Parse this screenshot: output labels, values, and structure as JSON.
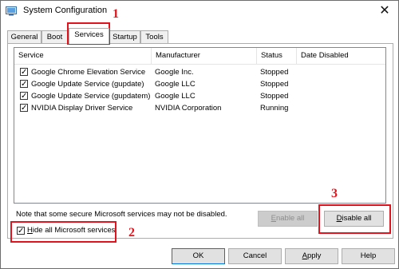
{
  "window": {
    "title": "System Configuration",
    "close_glyph": "✕"
  },
  "tabs": [
    {
      "label": "General"
    },
    {
      "label": "Boot"
    },
    {
      "label": "Services",
      "active": true
    },
    {
      "label": "Startup"
    },
    {
      "label": "Tools"
    }
  ],
  "services": {
    "columns": [
      "Service",
      "Manufacturer",
      "Status",
      "Date Disabled"
    ],
    "rows": [
      {
        "checked": true,
        "service": "Google Chrome Elevation Service",
        "manufacturer": "Google Inc.",
        "status": "Stopped",
        "date_disabled": ""
      },
      {
        "checked": true,
        "service": "Google Update Service (gupdate)",
        "manufacturer": "Google LLC",
        "status": "Stopped",
        "date_disabled": ""
      },
      {
        "checked": true,
        "service": "Google Update Service (gupdatem)",
        "manufacturer": "Google LLC",
        "status": "Stopped",
        "date_disabled": ""
      },
      {
        "checked": true,
        "service": "NVIDIA Display Driver Service",
        "manufacturer": "NVIDIA Corporation",
        "status": "Running",
        "date_disabled": ""
      }
    ],
    "note": "Note that some secure Microsoft services may not be disabled.",
    "enable_all": {
      "mnemonic": "E",
      "rest": "nable all"
    },
    "disable_all": {
      "mnemonic": "D",
      "rest": "isable all"
    },
    "hide_microsoft": {
      "checked": true,
      "mnemonic": "H",
      "rest": "ide all Microsoft services"
    }
  },
  "dialog_buttons": {
    "ok": "OK",
    "cancel": "Cancel",
    "apply": {
      "mnemonic": "A",
      "rest": "pply"
    },
    "help": "Help"
  },
  "annotations": {
    "step1": "1",
    "step2": "2",
    "step3": "3",
    "color": "#e0141c"
  },
  "icons": {
    "app": "system-config-icon",
    "check": "checkmark-icon",
    "check_glyph": "✓"
  }
}
